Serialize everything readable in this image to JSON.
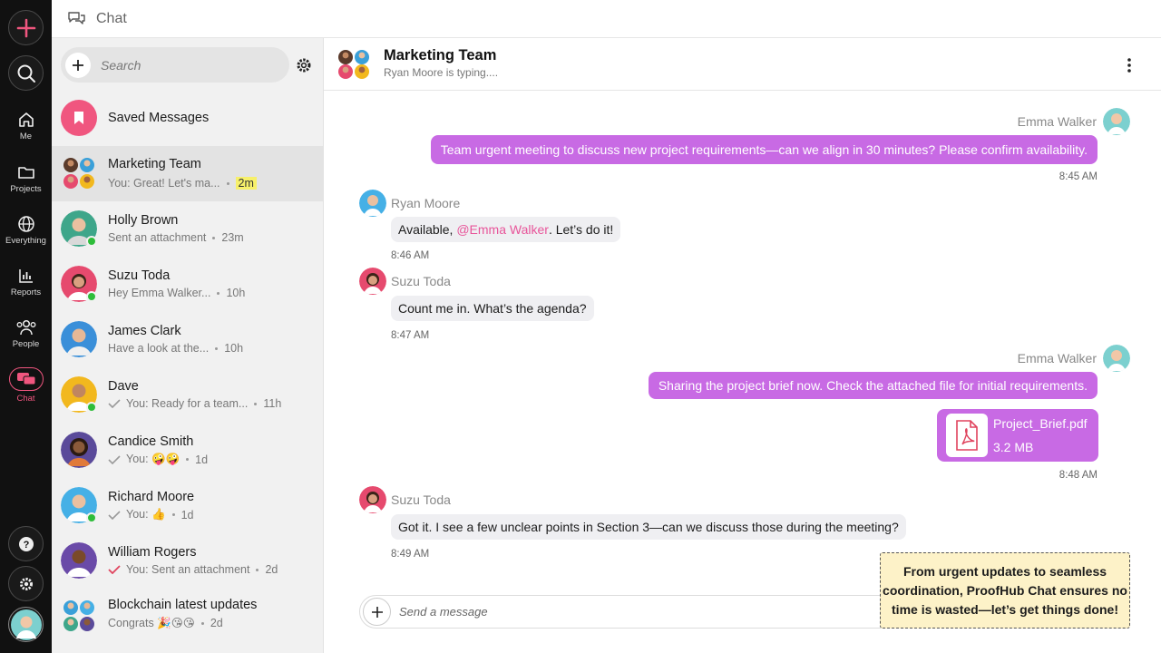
{
  "rail": {
    "items": [
      {
        "label": "Me",
        "icon": "home-icon"
      },
      {
        "label": "Projects",
        "icon": "folder-icon"
      },
      {
        "label": "Everything",
        "icon": "globe-icon"
      },
      {
        "label": "Reports",
        "icon": "bar-chart-icon"
      },
      {
        "label": "People",
        "icon": "people-icon"
      },
      {
        "label": "Chat",
        "icon": "chat-icon"
      }
    ],
    "accent": "#f0567f"
  },
  "header": {
    "title": "Chat",
    "icon": "chat-icon"
  },
  "list": {
    "search_placeholder": "Search",
    "saved": "Saved Messages",
    "conversations": [
      {
        "name": "Marketing Team",
        "preview": "You: Great! Let's ma...",
        "time": "2m"
      },
      {
        "name": "Holly Brown",
        "preview": "Sent an attachment",
        "time": "23m"
      },
      {
        "name": "Suzu Toda",
        "preview": "Hey Emma Walker...",
        "time": "10h"
      },
      {
        "name": "James Clark",
        "preview": "Have a look at the...",
        "time": "10h"
      },
      {
        "name": "Dave",
        "preview": "You: Ready for a team...",
        "time": "11h"
      },
      {
        "name": "Candice Smith",
        "preview": "You: 🤪🤪",
        "time": "1d"
      },
      {
        "name": "Richard Moore",
        "preview": "You: 👍",
        "time": "1d"
      },
      {
        "name": "William Rogers",
        "preview": "You: Sent an attachment",
        "time": "2d"
      },
      {
        "name": "Blockchain latest updates",
        "preview": "Congrats 🎉😘😘",
        "time": "2d"
      }
    ]
  },
  "chat": {
    "title": "Marketing Team",
    "status": "Ryan Moore is typing....",
    "messages": [
      {
        "sender": "Emma Walker",
        "text": "Team urgent meeting to discuss new project requirements—can we align in 30 minutes? Please confirm availability.",
        "time": "8:45 AM"
      },
      {
        "sender": "Ryan Moore",
        "text_before": "Available, ",
        "mention": "@Emma Walker",
        "text_after": ". Let’s do it!",
        "time": "8:46 AM"
      },
      {
        "sender": "Suzu Toda",
        "text": "Count me in. What’s the agenda?",
        "time": "8:47 AM"
      },
      {
        "sender": "Emma Walker",
        "text": "Sharing the project brief now. Check the attached file for initial requirements.",
        "file_name": "Project_Brief.pdf",
        "file_size": "3.2 MB",
        "time": "8:48 AM"
      },
      {
        "sender": "Suzu Toda",
        "text": "Got it. I see a few unclear points in Section 3—can we discuss those during the meeting?",
        "time": "8:49 AM"
      }
    ],
    "composer_placeholder": "Send a message",
    "bubble_color": "#c86ae4"
  },
  "callout": {
    "text": "From urgent updates to seamless coordination, ProofHub Chat ensures no time is wasted—let’s get things done!"
  }
}
